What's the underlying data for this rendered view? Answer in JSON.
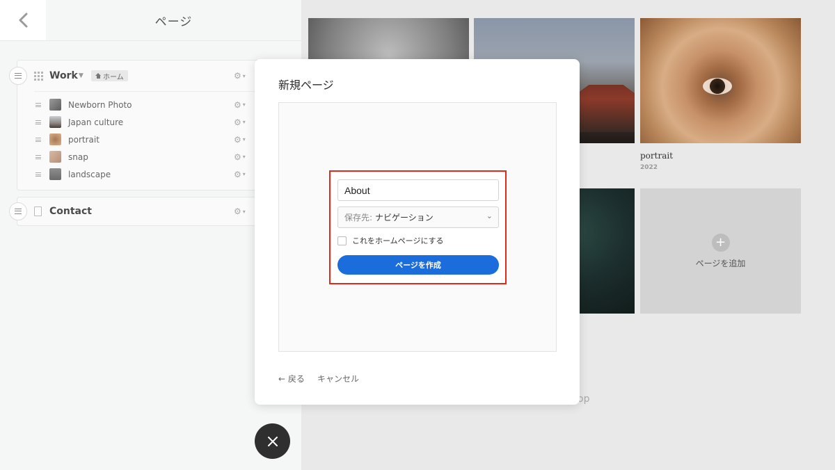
{
  "left_panel": {
    "title": "ページ",
    "groups": [
      {
        "name": "Work",
        "home_badge": "ホーム",
        "pages": [
          {
            "label": "Newborn Photo"
          },
          {
            "label": "Japan culture"
          },
          {
            "label": "portrait"
          },
          {
            "label": "snap"
          },
          {
            "label": "landscape"
          }
        ]
      },
      {
        "name": "Contact"
      }
    ]
  },
  "grid": {
    "cards": [
      {
        "caption": "portrait",
        "year": "2022"
      }
    ],
    "add_label": "ページを追加",
    "partial_text": "op"
  },
  "modal": {
    "title": "新規ページ",
    "name_value": "About",
    "select_prefix": "保存先:",
    "select_value": "ナビゲーション",
    "checkbox_label": "これをホームページにする",
    "create_button": "ページを作成",
    "back_link": "← 戻る",
    "cancel_link": "キャンセル"
  },
  "colors": {
    "primary": "#1a6ddb",
    "highlight_border": "#e0281b",
    "fab": "#2f2f2f"
  }
}
